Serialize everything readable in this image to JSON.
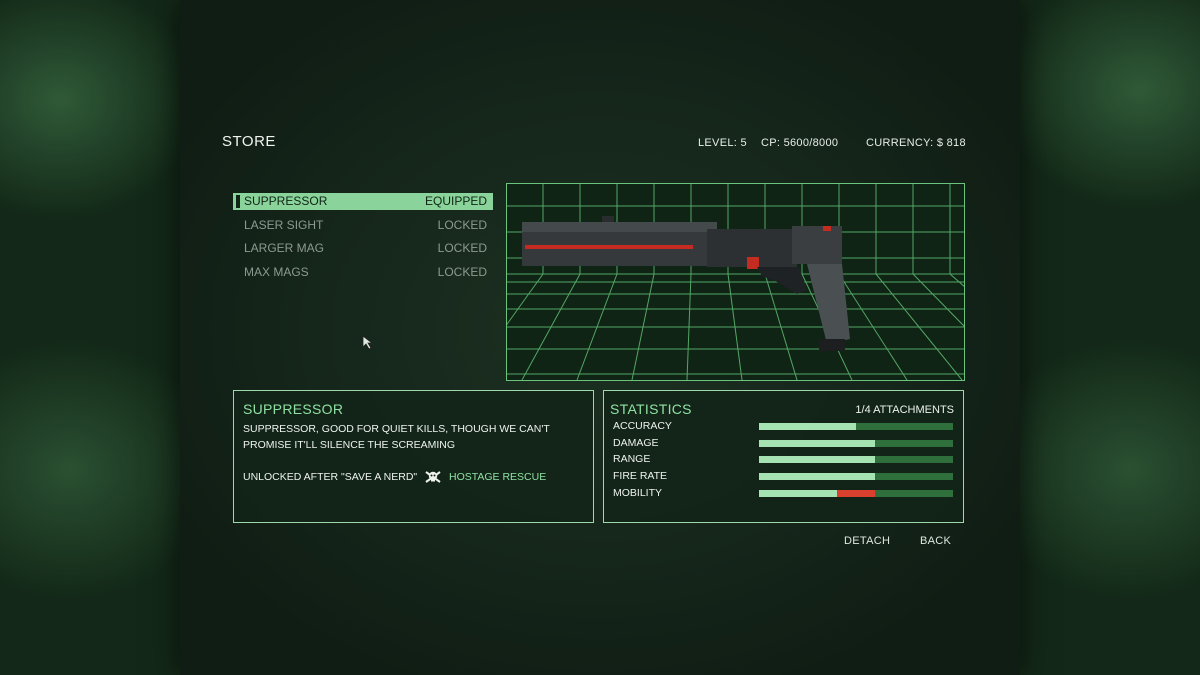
{
  "header": {
    "title": "STORE",
    "level": "LEVEL: 5",
    "cp": "CP: 5600/8000",
    "currency": "CURRENCY: $ 818"
  },
  "attachments": [
    {
      "name": "SUPPRESSOR",
      "status": "EQUIPPED",
      "selected": true
    },
    {
      "name": "LASER SIGHT",
      "status": "LOCKED",
      "selected": false
    },
    {
      "name": "LARGER MAG",
      "status": "LOCKED",
      "selected": false
    },
    {
      "name": "MAX MAGS",
      "status": "LOCKED",
      "selected": false
    }
  ],
  "description": {
    "title": "SUPPRESSOR",
    "text": "SUPPRESSOR, GOOD FOR QUIET KILLS, THOUGH WE CAN'T PROMISE IT'LL SILENCE THE SCREAMING",
    "unlock_prefix": "UNLOCKED AFTER \"SAVE A NERD\"",
    "unlock_icon": "skull-crossbones-icon",
    "unlock_mission": "HOSTAGE RESCUE"
  },
  "statistics": {
    "title": "STATISTICS",
    "attachments_count": "1/4 ATTACHMENTS",
    "stats": [
      {
        "label": "ACCURACY",
        "value": 0.5
      },
      {
        "label": "DAMAGE",
        "value": 0.6
      },
      {
        "label": "RANGE",
        "value": 0.6
      },
      {
        "label": "FIRE RATE",
        "value": 0.6
      },
      {
        "label": "MOBILITY",
        "value": 0.4,
        "penalty": 0.2
      }
    ]
  },
  "buttons": {
    "detach": "DETACH",
    "back": "BACK"
  },
  "colors": {
    "accent": "#8fe0a2",
    "grid": "#6bc47e",
    "penalty": "#d9412e",
    "bar_fill": "#a5e3b2",
    "bar_track": "#2e6f3c"
  },
  "weapon": {
    "name": "suppressed-pistol-model"
  }
}
